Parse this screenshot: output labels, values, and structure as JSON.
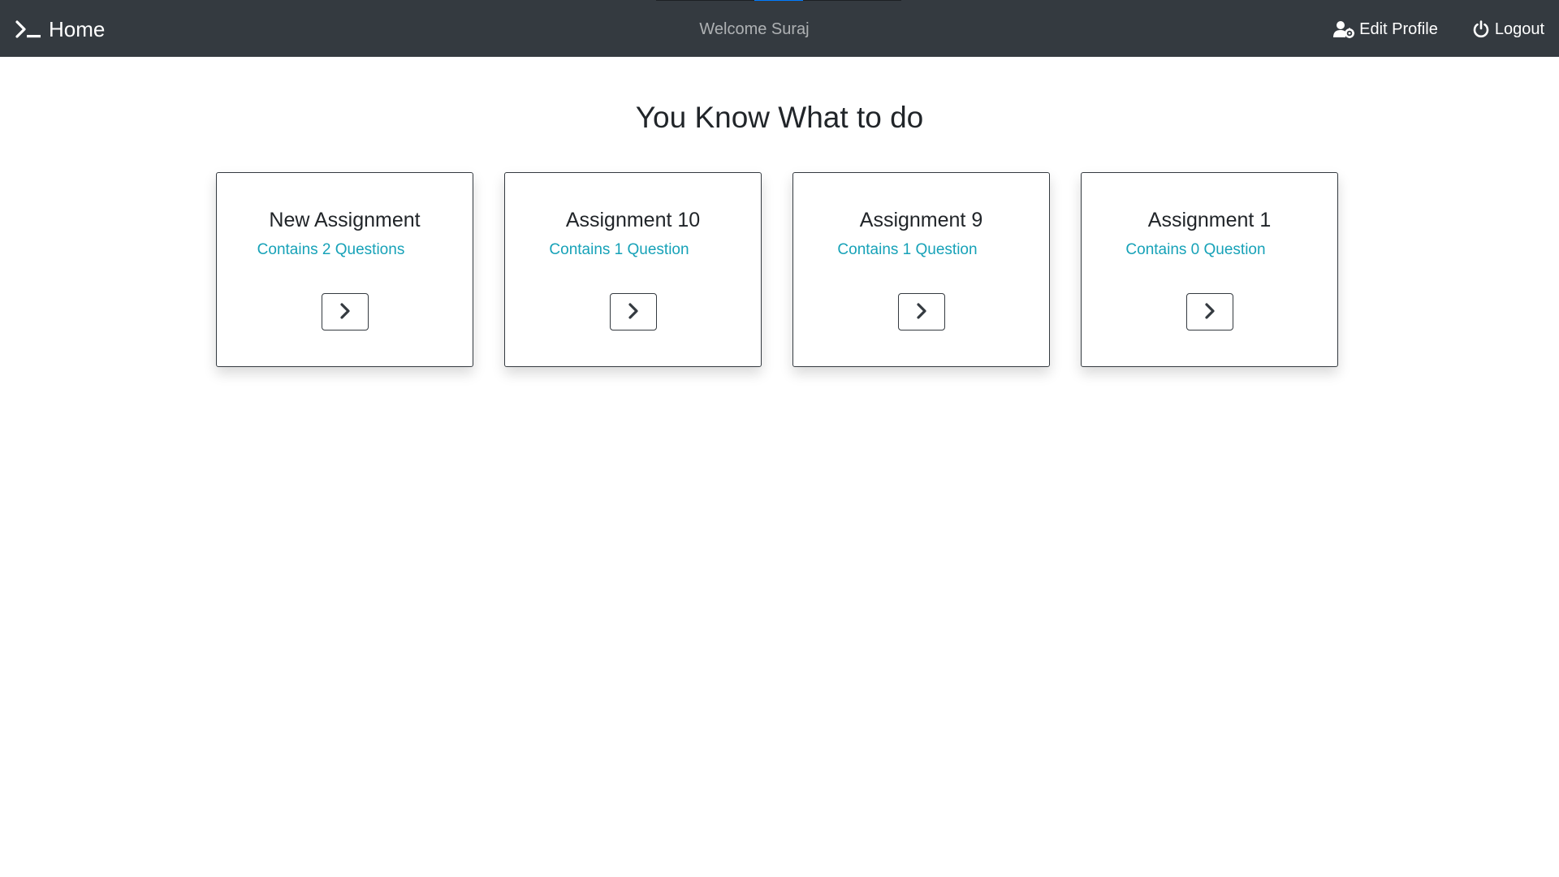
{
  "navbar": {
    "brand_label": "Home",
    "brand_icon": "terminal-icon",
    "welcome_text": "Welcome Suraj",
    "edit_profile_label": "Edit Profile",
    "edit_profile_icon": "user-cog-icon",
    "logout_label": "Logout",
    "logout_icon": "power-icon",
    "background": "#343a40"
  },
  "main": {
    "title": "You Know What to do",
    "cards": [
      {
        "title": "New Assignment",
        "subtitle": "Contains 2 Questions",
        "button_icon": "chevron-right-icon"
      },
      {
        "title": "Assignment 10",
        "subtitle": "Contains 1 Question",
        "button_icon": "chevron-right-icon"
      },
      {
        "title": "Assignment 9",
        "subtitle": "Contains 1 Question",
        "button_icon": "chevron-right-icon"
      },
      {
        "title": "Assignment 1",
        "subtitle": "Contains 0 Question",
        "button_icon": "chevron-right-icon"
      }
    ]
  },
  "colors": {
    "accent": "#17a2b8",
    "text": "#212529",
    "border": "#343a40",
    "progress": "#007bff"
  }
}
